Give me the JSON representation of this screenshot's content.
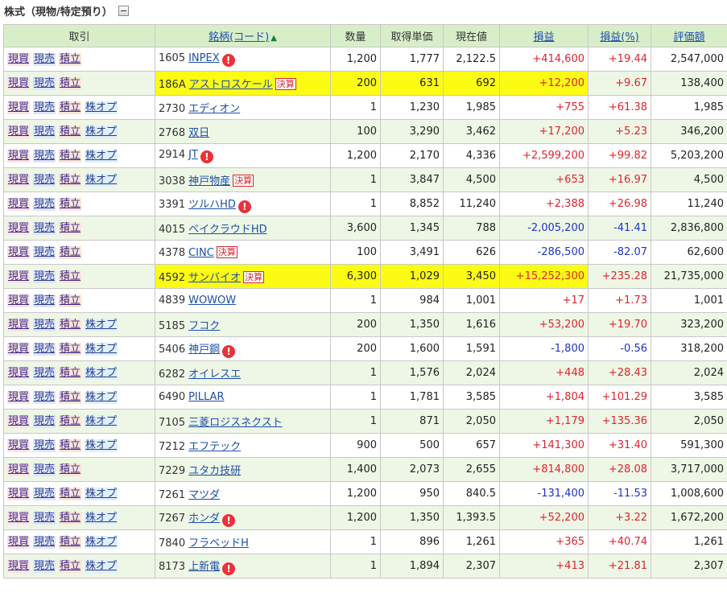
{
  "section": {
    "title": "株式（現物/特定預り）"
  },
  "headers": {
    "trade": "取引",
    "name": "銘柄(コード)",
    "qty": "数量",
    "cost": "取得単価",
    "price": "現在値",
    "pl": "損益",
    "plpct": "損益(%)",
    "value": "評価額"
  },
  "colors": {
    "positive": "#e2222c",
    "negative": "#1f33c9",
    "highlight": "#fbfb14",
    "header_bg": "#d8eec8"
  },
  "trade_labels": {
    "buy": "現買",
    "sell": "現売",
    "accumulate": "積立",
    "option": "株オプ"
  },
  "badge_label": "決算",
  "alert_glyph": "!",
  "rows": [
    {
      "code": "1605",
      "name": "INPEX",
      "qty": "1,200",
      "cost": "1,777",
      "price": "2,122.5",
      "pl": "+414,600",
      "plpct": "+19.44",
      "value": "2,547,000",
      "sign": "pos",
      "opt": false,
      "alert": true,
      "badge": false,
      "hl": false
    },
    {
      "code": "186A",
      "name": "アストロスケール",
      "qty": "200",
      "cost": "631",
      "price": "692",
      "pl": "+12,200",
      "plpct": "+9.67",
      "value": "138,400",
      "sign": "pos",
      "opt": false,
      "alert": false,
      "badge": true,
      "hl": true
    },
    {
      "code": "2730",
      "name": "エディオン",
      "qty": "1",
      "cost": "1,230",
      "price": "1,985",
      "pl": "+755",
      "plpct": "+61.38",
      "value": "1,985",
      "sign": "pos",
      "opt": true,
      "alert": false,
      "badge": false,
      "hl": false
    },
    {
      "code": "2768",
      "name": "双日",
      "qty": "100",
      "cost": "3,290",
      "price": "3,462",
      "pl": "+17,200",
      "plpct": "+5.23",
      "value": "346,200",
      "sign": "pos",
      "opt": true,
      "alert": false,
      "badge": false,
      "hl": false
    },
    {
      "code": "2914",
      "name": "JT",
      "qty": "1,200",
      "cost": "2,170",
      "price": "4,336",
      "pl": "+2,599,200",
      "plpct": "+99.82",
      "value": "5,203,200",
      "sign": "pos",
      "opt": true,
      "alert": true,
      "badge": false,
      "hl": false
    },
    {
      "code": "3038",
      "name": "神戸物産",
      "qty": "1",
      "cost": "3,847",
      "price": "4,500",
      "pl": "+653",
      "plpct": "+16.97",
      "value": "4,500",
      "sign": "pos",
      "opt": true,
      "alert": false,
      "badge": true,
      "hl": false
    },
    {
      "code": "3391",
      "name": "ツルハHD",
      "qty": "1",
      "cost": "8,852",
      "price": "11,240",
      "pl": "+2,388",
      "plpct": "+26.98",
      "value": "11,240",
      "sign": "pos",
      "opt": false,
      "alert": true,
      "badge": false,
      "hl": false
    },
    {
      "code": "4015",
      "name": "ベイクラウドHD",
      "qty": "3,600",
      "cost": "1,345",
      "price": "788",
      "pl": "-2,005,200",
      "plpct": "-41.41",
      "value": "2,836,800",
      "sign": "neg",
      "opt": false,
      "alert": false,
      "badge": false,
      "hl": false
    },
    {
      "code": "4378",
      "name": "CINC",
      "qty": "100",
      "cost": "3,491",
      "price": "626",
      "pl": "-286,500",
      "plpct": "-82.07",
      "value": "62,600",
      "sign": "neg",
      "opt": false,
      "alert": false,
      "badge": true,
      "hl": false
    },
    {
      "code": "4592",
      "name": "サンバイオ",
      "qty": "6,300",
      "cost": "1,029",
      "price": "3,450",
      "pl": "+15,252,300",
      "plpct": "+235.28",
      "value": "21,735,000",
      "sign": "pos",
      "opt": false,
      "alert": false,
      "badge": true,
      "hl": true
    },
    {
      "code": "4839",
      "name": "WOWOW",
      "qty": "1",
      "cost": "984",
      "price": "1,001",
      "pl": "+17",
      "plpct": "+1.73",
      "value": "1,001",
      "sign": "pos",
      "opt": false,
      "alert": false,
      "badge": false,
      "hl": false
    },
    {
      "code": "5185",
      "name": "フコク",
      "qty": "200",
      "cost": "1,350",
      "price": "1,616",
      "pl": "+53,200",
      "plpct": "+19.70",
      "value": "323,200",
      "sign": "pos",
      "opt": true,
      "alert": false,
      "badge": false,
      "hl": false
    },
    {
      "code": "5406",
      "name": "神戸鋼",
      "qty": "200",
      "cost": "1,600",
      "price": "1,591",
      "pl": "-1,800",
      "plpct": "-0.56",
      "value": "318,200",
      "sign": "neg",
      "opt": true,
      "alert": true,
      "badge": false,
      "hl": false
    },
    {
      "code": "6282",
      "name": "オイレスエ",
      "qty": "1",
      "cost": "1,576",
      "price": "2,024",
      "pl": "+448",
      "plpct": "+28.43",
      "value": "2,024",
      "sign": "pos",
      "opt": true,
      "alert": false,
      "badge": false,
      "hl": false
    },
    {
      "code": "6490",
      "name": "PILLAR",
      "qty": "1",
      "cost": "1,781",
      "price": "3,585",
      "pl": "+1,804",
      "plpct": "+101.29",
      "value": "3,585",
      "sign": "pos",
      "opt": true,
      "alert": false,
      "badge": false,
      "hl": false
    },
    {
      "code": "7105",
      "name": "三菱ロジスネクスト",
      "qty": "1",
      "cost": "871",
      "price": "2,050",
      "pl": "+1,179",
      "plpct": "+135.36",
      "value": "2,050",
      "sign": "pos",
      "opt": true,
      "alert": false,
      "badge": false,
      "hl": false
    },
    {
      "code": "7212",
      "name": "エフテック",
      "qty": "900",
      "cost": "500",
      "price": "657",
      "pl": "+141,300",
      "plpct": "+31.40",
      "value": "591,300",
      "sign": "pos",
      "opt": true,
      "alert": false,
      "badge": false,
      "hl": false
    },
    {
      "code": "7229",
      "name": "ユタカ技研",
      "qty": "1,400",
      "cost": "2,073",
      "price": "2,655",
      "pl": "+814,800",
      "plpct": "+28.08",
      "value": "3,717,000",
      "sign": "pos",
      "opt": false,
      "alert": false,
      "badge": false,
      "hl": false
    },
    {
      "code": "7261",
      "name": "マツダ",
      "qty": "1,200",
      "cost": "950",
      "price": "840.5",
      "pl": "-131,400",
      "plpct": "-11.53",
      "value": "1,008,600",
      "sign": "neg",
      "opt": true,
      "alert": false,
      "badge": false,
      "hl": false
    },
    {
      "code": "7267",
      "name": "ホンダ",
      "qty": "1,200",
      "cost": "1,350",
      "price": "1,393.5",
      "pl": "+52,200",
      "plpct": "+3.22",
      "value": "1,672,200",
      "sign": "pos",
      "opt": true,
      "alert": true,
      "badge": false,
      "hl": false
    },
    {
      "code": "7840",
      "name": "フラベッドH",
      "qty": "1",
      "cost": "896",
      "price": "1,261",
      "pl": "+365",
      "plpct": "+40.74",
      "value": "1,261",
      "sign": "pos",
      "opt": true,
      "alert": false,
      "badge": false,
      "hl": false
    },
    {
      "code": "8173",
      "name": "上新電",
      "qty": "1",
      "cost": "1,894",
      "price": "2,307",
      "pl": "+413",
      "plpct": "+21.81",
      "value": "2,307",
      "sign": "pos",
      "opt": true,
      "alert": true,
      "badge": false,
      "hl": false
    }
  ]
}
